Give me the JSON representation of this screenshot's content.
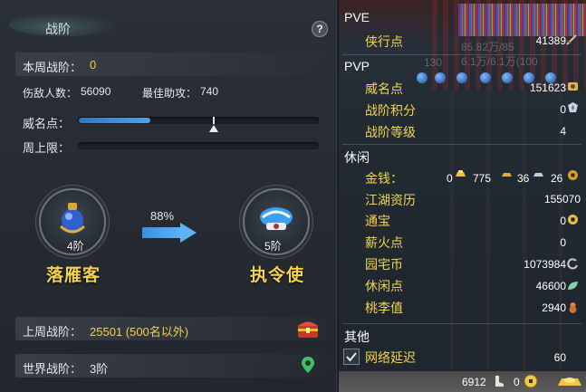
{
  "left_panel": {
    "title": "战阶",
    "help": "?",
    "weekly_label": "本周战阶：",
    "weekly_value": "0",
    "kills_label": "伤敌人数：",
    "kills_value": "56090",
    "assist_label": "最佳助攻：",
    "assist_value": "740",
    "prestige_label": "威名点：",
    "prestige_progress": 0.3,
    "weekly_cap_label": "周上限：",
    "weekly_cap_progress": 0,
    "current_rank": {
      "tier": "4阶",
      "name": "落雁客"
    },
    "next_rank": {
      "tier": "5阶",
      "name": "执令使"
    },
    "progress_percent": "88%",
    "last_week_label": "上周战阶：",
    "last_week_value": "25501 (500名以外)",
    "world_label": "世界战阶：",
    "world_value": "3阶"
  },
  "right_panel": {
    "pve": {
      "header": "PVE",
      "items": [
        {
          "label": "侠行点",
          "value": "41389",
          "icon": "sword-icon"
        }
      ]
    },
    "pvp": {
      "header": "PVP",
      "items": [
        {
          "label": "威名点",
          "value": "151623",
          "icon": "prestige-icon"
        },
        {
          "label": "战阶积分",
          "value": "0",
          "icon": "rank-badge-icon"
        },
        {
          "label": "战阶等级",
          "value": "4",
          "icon": ""
        }
      ]
    },
    "leisure": {
      "header": "休闲",
      "money": {
        "label": "金钱：",
        "gold": "0",
        "silver": "775",
        "copper": "36",
        "bronze": "26"
      },
      "items": [
        {
          "label": "江湖资历",
          "value": "155070",
          "icon": ""
        },
        {
          "label": "通宝",
          "value": "0",
          "icon": "coin-icon"
        },
        {
          "label": "薪火点",
          "value": "0",
          "icon": ""
        },
        {
          "label": "园宅币",
          "value": "1073984",
          "icon": "house-coin-icon"
        },
        {
          "label": "休闲点",
          "value": "46600",
          "icon": "leaf-icon"
        },
        {
          "label": "桃李值",
          "value": "2940",
          "icon": "gourd-icon"
        }
      ]
    },
    "other": {
      "header": "其他",
      "latency_label": "网络延迟",
      "latency_value": "60",
      "latency_checked": true
    },
    "bottom_bar": {
      "value1": "6912",
      "value2": "0"
    },
    "background_text": [
      "85.82万/85",
      "6.1万/6.1万(100",
      "130"
    ]
  },
  "colors": {
    "gold_text": "#f3d34a",
    "progress_blue": "#3f96e6",
    "panel_bg": "#262a31"
  }
}
